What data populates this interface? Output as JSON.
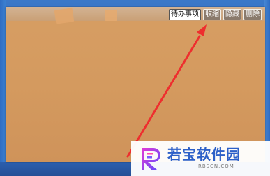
{
  "toolbar": {
    "todo_label": "待办事项",
    "collapse_label": "收缩",
    "hide_label": "隐藏",
    "delete_label": "删除"
  },
  "watermark": {
    "brand": "若宝软件园",
    "url": "RBSCN.COM"
  },
  "colors": {
    "note_background": "#d49a5f",
    "desktop_blue": "#2f6bbd",
    "arrow_red": "#ee2e2e",
    "watermark_text": "#2d60c8"
  }
}
